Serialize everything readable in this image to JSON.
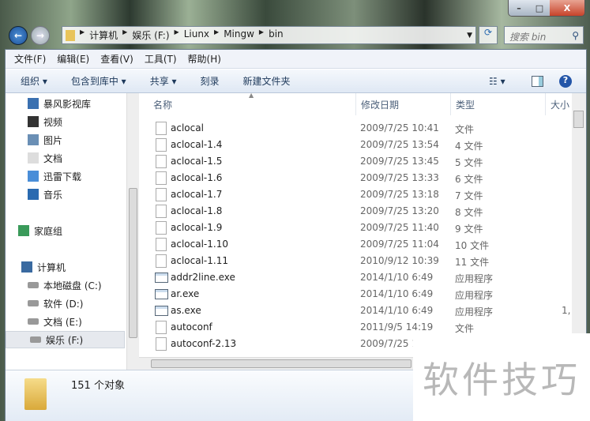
{
  "window": {
    "minimize": "–",
    "maximize": "□",
    "close": "X"
  },
  "address": {
    "segments": [
      "计算机",
      "娱乐 (F:)",
      "Liunx",
      "Mingw",
      "bin"
    ]
  },
  "search": {
    "placeholder": "搜索 bin"
  },
  "menu": [
    "文件(F)",
    "编辑(E)",
    "查看(V)",
    "工具(T)",
    "帮助(H)"
  ],
  "toolbar": [
    "组织 ▾",
    "包含到库中 ▾",
    "共享 ▾",
    "刻录",
    "新建文件夹"
  ],
  "sidebar": [
    {
      "label": "暴风影视库",
      "icon": "library-icon"
    },
    {
      "label": "视频",
      "icon": "video-icon"
    },
    {
      "label": "图片",
      "icon": "picture-icon"
    },
    {
      "label": "文档",
      "icon": "document-icon"
    },
    {
      "label": "迅雷下载",
      "icon": "download-icon"
    },
    {
      "label": "音乐",
      "icon": "music-icon"
    },
    {
      "label": "家庭组",
      "icon": "homegroup-icon"
    },
    {
      "label": "计算机",
      "icon": "computer-icon"
    },
    {
      "label": "本地磁盘 (C:)",
      "icon": "drive-icon"
    },
    {
      "label": "软件 (D:)",
      "icon": "drive-icon"
    },
    {
      "label": "文档 (E:)",
      "icon": "drive-icon"
    },
    {
      "label": "娱乐 (F:)",
      "icon": "drive-icon",
      "selected": true
    }
  ],
  "columns": [
    "名称",
    "修改日期",
    "类型",
    "大小"
  ],
  "files": [
    {
      "name": "aclocal",
      "date": "2009/7/25 10:41",
      "type": "文件",
      "size": "",
      "kind": "file"
    },
    {
      "name": "aclocal-1.4",
      "date": "2009/7/25 13:54",
      "type": "4 文件",
      "size": "",
      "kind": "file"
    },
    {
      "name": "aclocal-1.5",
      "date": "2009/7/25 13:45",
      "type": "5 文件",
      "size": "",
      "kind": "file"
    },
    {
      "name": "aclocal-1.6",
      "date": "2009/7/25 13:33",
      "type": "6 文件",
      "size": "",
      "kind": "file"
    },
    {
      "name": "aclocal-1.7",
      "date": "2009/7/25 13:18",
      "type": "7 文件",
      "size": "",
      "kind": "file"
    },
    {
      "name": "aclocal-1.8",
      "date": "2009/7/25 13:20",
      "type": "8 文件",
      "size": "",
      "kind": "file"
    },
    {
      "name": "aclocal-1.9",
      "date": "2009/7/25 11:40",
      "type": "9 文件",
      "size": "",
      "kind": "file"
    },
    {
      "name": "aclocal-1.10",
      "date": "2009/7/25 11:04",
      "type": "10 文件",
      "size": "",
      "kind": "file"
    },
    {
      "name": "aclocal-1.11",
      "date": "2010/9/12 10:39",
      "type": "11 文件",
      "size": "",
      "kind": "file"
    },
    {
      "name": "addr2line.exe",
      "date": "2014/1/10 6:49",
      "type": "应用程序",
      "size": "",
      "kind": "exe"
    },
    {
      "name": "ar.exe",
      "date": "2014/1/10 6:49",
      "type": "应用程序",
      "size": "",
      "kind": "exe"
    },
    {
      "name": "as.exe",
      "date": "2014/1/10 6:49",
      "type": "应用程序",
      "size": "1,",
      "kind": "exe"
    },
    {
      "name": "autoconf",
      "date": "2011/9/5 14:19",
      "type": "文件",
      "size": "",
      "kind": "file"
    },
    {
      "name": "autoconf-2.13",
      "date": "2009/7/25 1",
      "type": "",
      "size": "",
      "kind": "file"
    }
  ],
  "status": {
    "count": "151 个对象"
  },
  "watermark": "软件技巧"
}
